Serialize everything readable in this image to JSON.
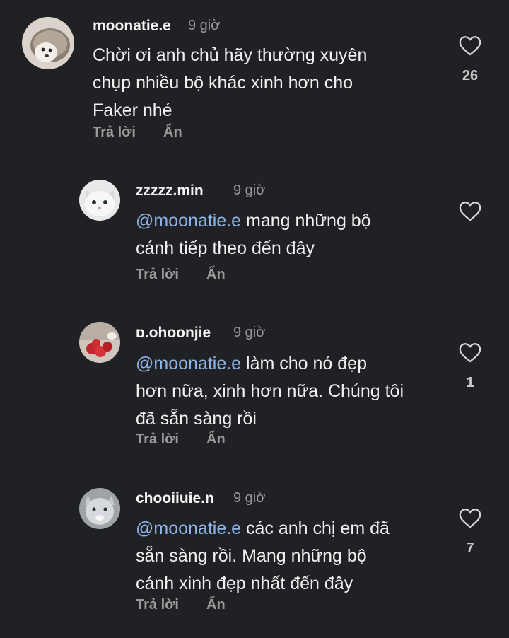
{
  "comments": [
    {
      "username": "moonatie.e",
      "time": "9 giờ",
      "mention": "",
      "text_lines": [
        "Chời ơi anh chủ hãy thường xuyên",
        "chụp nhiều bộ khác xinh hơn cho",
        "Faker nhé"
      ],
      "reply_label": "Trả lời",
      "hide_label": "Ẩn",
      "like_count": "26",
      "avatar": "hedgehog-avatar"
    },
    {
      "username": "zzzzz.min",
      "time": "9 giờ",
      "mention": "@moonatie.e",
      "text_lines": [
        " mang những bộ",
        "cánh tiếp theo đến đây"
      ],
      "reply_label": "Trả lời",
      "hide_label": "Ẩn",
      "like_count": "",
      "avatar": "white-cat-avatar"
    },
    {
      "username": "ɒ.ohoonjie",
      "time": "9 giờ",
      "mention": "@moonatie.e",
      "text_lines": [
        " làm cho nó đẹp",
        "hơn nữa, xinh hơn nữa. Chúng tôi",
        "đã sẵn sàng rồi"
      ],
      "reply_label": "Trả lời",
      "hide_label": "Ẩn",
      "like_count": "1",
      "avatar": "strawberry-avatar"
    },
    {
      "username": "chooiiuie.n",
      "time": "9 giờ",
      "mention": "@moonatie.e",
      "text_lines": [
        " các anh chị em đã",
        "sẵn sàng rồi. Mang những bộ",
        "cánh xinh đẹp nhất đến đây"
      ],
      "reply_label": "Trả lời",
      "hide_label": "Ẩn",
      "like_count": "7",
      "avatar": "gray-cat-avatar"
    }
  ],
  "colors": {
    "background": "#202124",
    "mention": "#8fb4e8",
    "muted": "#9a9a9a"
  }
}
